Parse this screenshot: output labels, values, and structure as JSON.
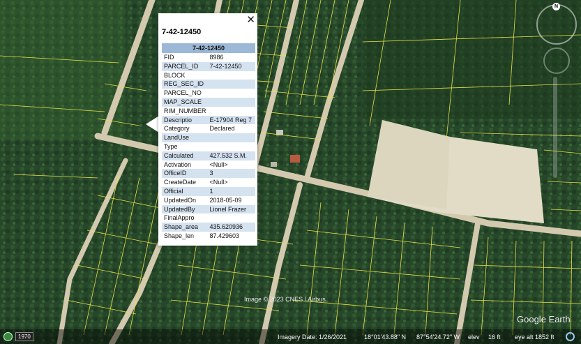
{
  "popup": {
    "title": "7-42-12450",
    "table_header": "7-42-12450",
    "close_symbol": "✕",
    "rows": [
      {
        "key": "FID",
        "value": "8986"
      },
      {
        "key": "PARCEL_ID",
        "value": "7-42-12450"
      },
      {
        "key": "BLOCK",
        "value": ""
      },
      {
        "key": "REG_SEC_ID",
        "value": ""
      },
      {
        "key": "PARCEL_NO",
        "value": ""
      },
      {
        "key": "MAP_SCALE",
        "value": ""
      },
      {
        "key": "RIM_NUMBER",
        "value": ""
      },
      {
        "key": "Descriptio",
        "value": "E-17904 Reg 7"
      },
      {
        "key": "Category",
        "value": "Declared"
      },
      {
        "key": "LandUse",
        "value": ""
      },
      {
        "key": "Type",
        "value": ""
      },
      {
        "key": "Calculated",
        "value": "427.532 S.M."
      },
      {
        "key": "Activation",
        "value": "<Null>"
      },
      {
        "key": "OfficeID",
        "value": "3"
      },
      {
        "key": "CreateDate",
        "value": "<Null>"
      },
      {
        "key": "Official",
        "value": "1"
      },
      {
        "key": "UpdatedOn",
        "value": "2018-05-09"
      },
      {
        "key": "UpdatedBy",
        "value": "Lionel Frazer"
      },
      {
        "key": "FinalAppro",
        "value": ""
      },
      {
        "key": "Shape_area",
        "value": "435.620936"
      },
      {
        "key": "Shape_len",
        "value": "87.429603"
      }
    ]
  },
  "attribution": "Image © 2023 CNES / Airbus",
  "status": {
    "year": "1970",
    "imagery_date": "Imagery Date: 1/26/2021",
    "lat": "18°01'43.88\" N",
    "lon": "87°54'24.72\" W",
    "elev_label": "elev",
    "elev_value": "16 ft",
    "eye_alt": "eye alt 1852 ft"
  },
  "logo": "Google Earth",
  "compass_letter": "N",
  "colors": {
    "parcel_line": "#e8e04a",
    "road": "#d6cdb3",
    "clearing": "#e4dec9",
    "vegetation": "#2a4d27",
    "table_header": "#9bb8d6",
    "row_alt": "#d5e2f0"
  }
}
